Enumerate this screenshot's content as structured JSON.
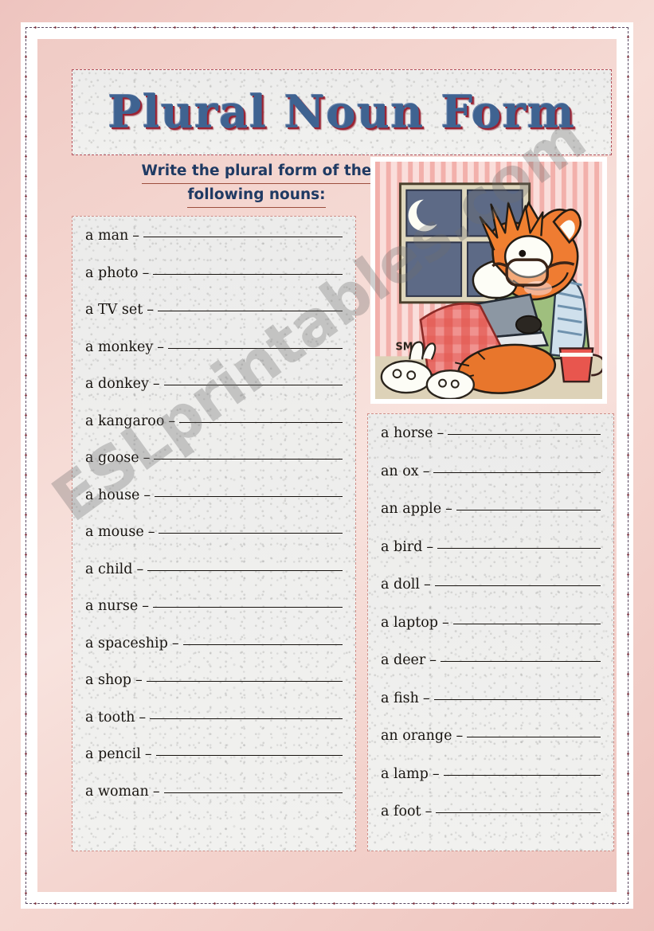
{
  "worksheet": {
    "title": "Plural Noun Form",
    "instruction_line1": "Write the plural form of the",
    "instruction_line2": "following nouns:",
    "watermark": "ESLprintables.com",
    "illustration_signature": "SM",
    "colors": {
      "page_background": "#f2cfc9",
      "title_blue": "#3f6391",
      "title_red_shadow": "#9c2232",
      "instruction_navy": "#1f3a63",
      "instruction_underline": "#9d4f3e",
      "box_border": "#cf8e88",
      "paper_texture": "#ededec",
      "frame_white": "#ffffff",
      "stitch_border": "#5b4a63"
    },
    "dash": "–"
  },
  "exercise_left": {
    "items": [
      {
        "noun": "a man"
      },
      {
        "noun": "a photo"
      },
      {
        "noun": "a TV set"
      },
      {
        "noun": "a monkey"
      },
      {
        "noun": "a donkey"
      },
      {
        "noun": "a kangaroo"
      },
      {
        "noun": "a goose"
      },
      {
        "noun": "a house"
      },
      {
        "noun": "a mouse"
      },
      {
        "noun": "a child"
      },
      {
        "noun": "a nurse"
      },
      {
        "noun": "a spaceship"
      },
      {
        "noun": "a shop"
      },
      {
        "noun": "a tooth"
      },
      {
        "noun": "a pencil"
      },
      {
        "noun": "a woman"
      }
    ]
  },
  "exercise_right": {
    "items": [
      {
        "noun": "a horse"
      },
      {
        "noun": "an ox"
      },
      {
        "noun": "an apple"
      },
      {
        "noun": "a bird"
      },
      {
        "noun": "a doll"
      },
      {
        "noun": "a laptop"
      },
      {
        "noun": "a deer"
      },
      {
        "noun": "a fish"
      },
      {
        "noun": "an orange"
      },
      {
        "noun": "a lamp"
      },
      {
        "noun": "a foot"
      }
    ]
  },
  "illustration": {
    "description": "Cartoon fox wearing glasses lying in bed at night with a laptop, red checked blanket, bunny slippers and a red mug, window with crescent moon"
  }
}
